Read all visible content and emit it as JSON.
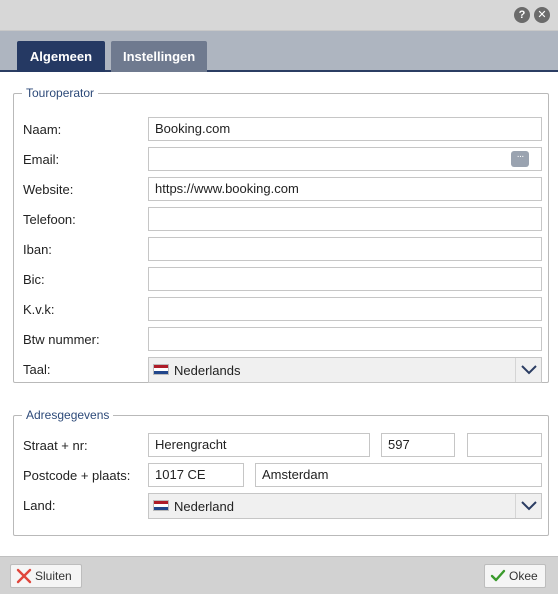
{
  "window": {
    "help_icon": "?",
    "close_icon": "✕"
  },
  "tabs": [
    {
      "label": "Algemeen",
      "active": true
    },
    {
      "label": "Instellingen",
      "active": false
    }
  ],
  "touroperator": {
    "legend": "Touroperator",
    "naam": {
      "label": "Naam:",
      "value": "Booking.com"
    },
    "email": {
      "label": "Email:",
      "value": "",
      "action_icon": "···"
    },
    "website": {
      "label": "Website:",
      "value": "https://www.booking.com"
    },
    "telefoon": {
      "label": "Telefoon:",
      "value": ""
    },
    "iban": {
      "label": "Iban:",
      "value": ""
    },
    "bic": {
      "label": "Bic:",
      "value": ""
    },
    "kvk": {
      "label": "K.v.k:",
      "value": ""
    },
    "btw": {
      "label": "Btw nummer:",
      "value": ""
    },
    "taal": {
      "label": "Taal:",
      "value": "Nederlands",
      "flag": [
        "#ae1c28",
        "#ffffff",
        "#21468b"
      ]
    }
  },
  "adres": {
    "legend": "Adresgegevens",
    "straat": {
      "label": "Straat + nr:",
      "street": "Herengracht",
      "number": "597",
      "addition": ""
    },
    "postcode": {
      "label": "Postcode + plaats:",
      "postcode": "1017 CE",
      "plaats": "Amsterdam"
    },
    "land": {
      "label": "Land:",
      "value": "Nederland",
      "flag": [
        "#ae1c28",
        "#ffffff",
        "#21468b"
      ]
    }
  },
  "footer": {
    "close_label": "Sluiten",
    "ok_label": "Okee"
  },
  "colors": {
    "tab_active": "#253963",
    "tab_inactive": "#6f7a8f",
    "legend_text": "#2d4a79",
    "close_icon_red": "#e0463b",
    "ok_icon_green": "#3a9a2c"
  }
}
